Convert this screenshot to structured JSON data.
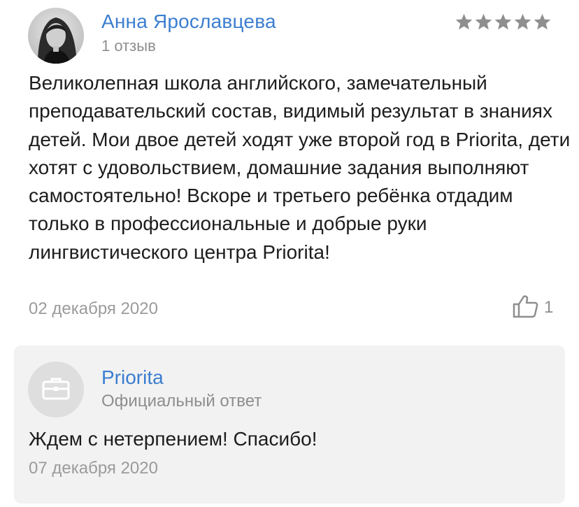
{
  "review": {
    "author_name": "Анна Ярославцева",
    "author_reviews": "1 отзыв",
    "rating": 5,
    "rating_max": 5,
    "text": "Великолепная школа английского, замечательный преподавательский состав, видимый результат в знаниях детей. Мои двое детей ходят уже второй год в Priorita, дети хотят с удовольствием, домашние задания выполняют самостоятельно! Вскоре и третьего ребёнка отдадим только в профессиональные и добрые руки лингвистического центра Priorita!",
    "date": "02 декабря 2020",
    "likes": "1",
    "star_color": "#8f8f8f",
    "name_color": "#3c7ed0"
  },
  "reply": {
    "author_name": "Priorita",
    "subtitle": "Официальный ответ",
    "icon": "briefcase-icon",
    "text": "Ждем с нетерпением! Спасибо!",
    "date": "07 декабря 2020",
    "background_color": "#f2f2f2"
  }
}
